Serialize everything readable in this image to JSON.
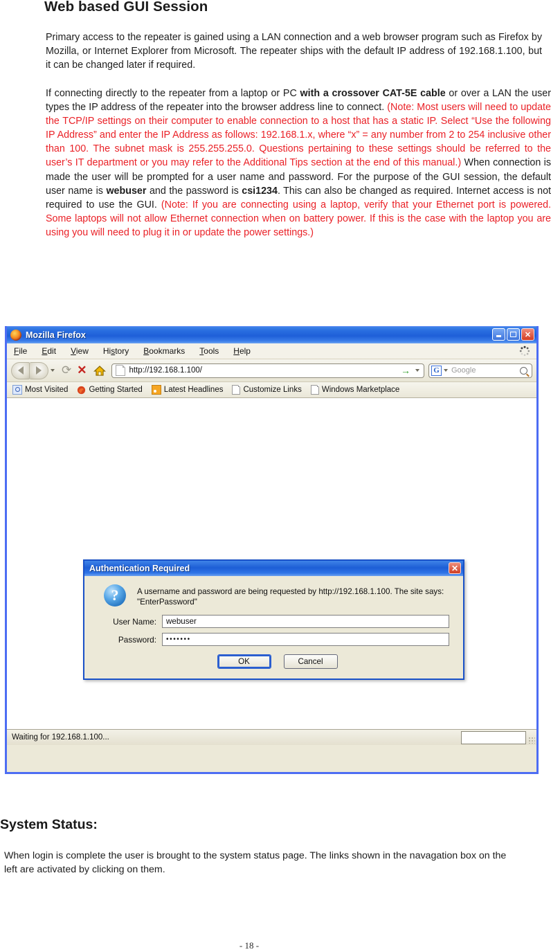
{
  "document": {
    "title": "Web based GUI Session",
    "paragraph_1": "Primary access to the repeater is  gained using a LAN connection and a web browser program such as Firefox by Mozilla, or Internet Explorer from Microsoft.  The repeater ships with the default IP address of 192.168.1.100, but it can be changed later if required.",
    "paragraph_2": {
      "part1": "If connecting directly to the repeater from a laptop or PC ",
      "bold1": "with a crossover CAT-5E cable",
      "part2": " or over a LAN the user types the IP address of the repeater into the browser address line to connect. ",
      "red1": "(Note: Most users will need to update the TCP/IP settings on their computer to enable connection to a host that has a static IP.  Select “Use the following IP Address” and enter the IP Address as follows: 192.168.1.x, where “x” = any number from 2 to 254 inclusive other than 100. The subnet mask is 255.255.255.0.  Questions pertaining to these settings should be referred to the user’s IT department or you may refer to the Additional Tips section at the end of this manual.)",
      "part3": "  When connection is made the user will be prompted for a user name and password. For the purpose of the GUI session, the default user name is ",
      "bold2": "webuser",
      "part4": " and the password is ",
      "bold3": "csi1234",
      "part5": ".  This can also be changed as required. Internet access is not required to use the GUI.  ",
      "red2": "(Note: If you are connecting using a laptop, verify that your Ethernet port is powered.  Some laptops will not allow Ethernet connection when on battery power. If this is the case with the laptop you are using you will need to plug it in or update the power settings.)"
    },
    "section_title": "System Status:",
    "section_body": "When login is complete the user is brought to the system status page. The links shown in the navagation box on the left are activated by clicking on them.",
    "page_number": "- 18 -"
  },
  "browser": {
    "window_title": "Mozilla Firefox",
    "window_buttons": {
      "minimize": "minimize",
      "maximize": "maximize",
      "close": "✕"
    },
    "menu": [
      {
        "pre": "",
        "accel": "F",
        "post": "ile"
      },
      {
        "pre": "",
        "accel": "E",
        "post": "dit"
      },
      {
        "pre": "",
        "accel": "V",
        "post": "iew"
      },
      {
        "pre": "Hi",
        "accel": "s",
        "post": "tory"
      },
      {
        "pre": "",
        "accel": "B",
        "post": "ookmarks"
      },
      {
        "pre": "",
        "accel": "T",
        "post": "ools"
      },
      {
        "pre": "",
        "accel": "H",
        "post": "elp"
      }
    ],
    "toolbar": {
      "back": "Back",
      "forward": "Forward",
      "reload": "⟳",
      "stop": "✕",
      "home": "Home",
      "url": "http://192.168.1.100/",
      "go": "→",
      "search_engine": "G",
      "search_placeholder": "Google"
    },
    "bookmarks": [
      {
        "label": "Most Visited",
        "icon": "blue-globe-icon"
      },
      {
        "label": "Getting Started",
        "icon": "firefox-icon"
      },
      {
        "label": "Latest Headlines",
        "icon": "rss-feed-icon"
      },
      {
        "label": "Customize Links",
        "icon": "page-icon"
      },
      {
        "label": "Windows Marketplace",
        "icon": "page-icon"
      }
    ],
    "status": {
      "text": "Waiting for 192.168.1.100..."
    }
  },
  "auth_dialog": {
    "title": "Authentication Required",
    "close_label": "✕",
    "icon": "question-mark-icon",
    "message_line1": "A username and password are being requested by http://192.168.1.100. The site says:",
    "message_line2": "\"EnterPassword\"",
    "username_label": "User Name:",
    "username_value": "webuser",
    "password_label": "Password:",
    "password_value": "•••••••",
    "ok_label": "OK",
    "cancel_label": "Cancel"
  },
  "colors": {
    "red_note": "#ea2127",
    "title_bar_blue": "#1d5ed6",
    "dialog_bg": "#ece9d8"
  }
}
